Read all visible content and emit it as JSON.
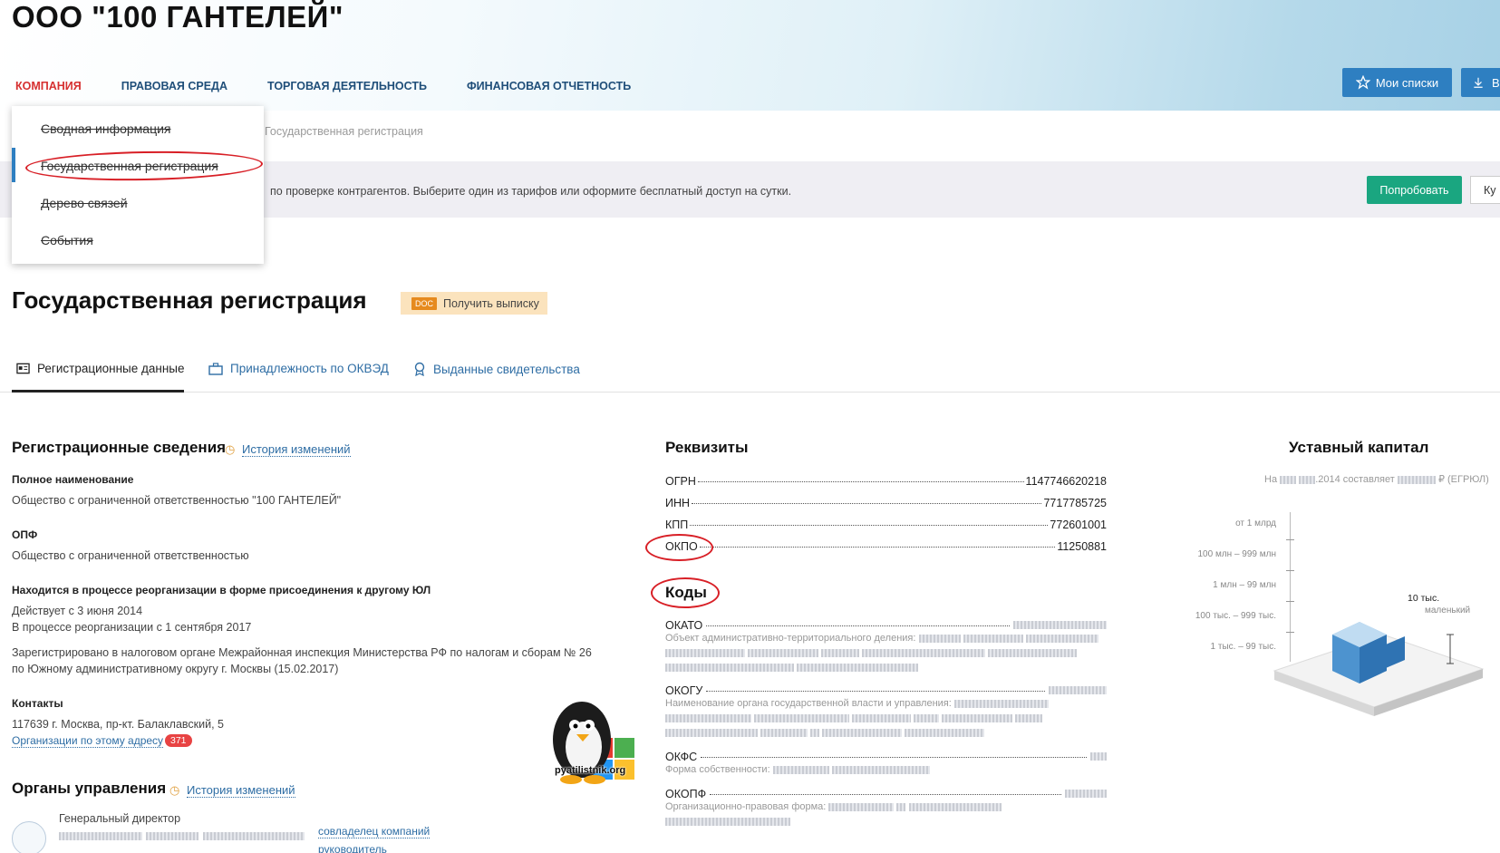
{
  "company": {
    "title": "ООО \"100 ГАНТЕЛЕЙ\""
  },
  "nav": {
    "items": [
      "КОМПАНИЯ",
      "ПРАВОВАЯ СРЕДА",
      "ТОРГОВАЯ ДЕЯТЕЛЬНОСТЬ",
      "ФИНАНСОВАЯ ОТЧЕТНОСТЬ"
    ],
    "my_lists": "Мои списки",
    "download": "В"
  },
  "dropdown": {
    "items": [
      "Сводная информация",
      "Государственная регистрация",
      "Дерево связей",
      "События"
    ]
  },
  "breadcrumb": "Государственная регистрация",
  "promo": {
    "text": "по проверке контрагентов. Выберите один из тарифов или оформите бесплатный доступ на сутки.",
    "try": "Попробовать",
    "buy": "Ку"
  },
  "page": {
    "title": "Государственная регистрация",
    "doc_badge": "DOC",
    "doc_label": "Получить выписку"
  },
  "tabs": [
    "Регистрационные данные",
    "Принадлежность по ОКВЭД",
    "Выданные свидетельства"
  ],
  "reg": {
    "title": "Регистрационные сведения",
    "history": "История изменений",
    "full_name_label": "Полное наименование",
    "full_name": "Общество с ограниченной ответственностью \"100 ГАНТЕЛЕЙ\"",
    "opf_label": "ОПФ",
    "opf": "Общество с ограниченной ответственностью",
    "reorg_label": "Находится в процессе реорганизации в форме присоединения к другому ЮЛ",
    "reorg_since": "Действует с 3 июня 2014",
    "reorg_process": "В процессе реорганизации с 1 сентября 2017",
    "registered_1": "Зарегистрировано в налоговом органе Межрайонная инспекция Министерства РФ по налогам и сборам № 26",
    "registered_2": "по Южному административному округу г. Москвы (15.02.2017)",
    "contacts_label": "Контакты",
    "address": "117639 г. Москва, пр-кт. Балаклавский, 5",
    "orgs_link": "Организации по этому адресу",
    "orgs_count": "371"
  },
  "mgmt": {
    "title": "Органы управления",
    "history": "История изменений",
    "role": "Генеральный директор",
    "link1": "совладелец компаний",
    "link2": "руководитель"
  },
  "requisites": {
    "title": "Реквизиты",
    "rows": [
      {
        "k": "ОГРН",
        "v": "1147746620218"
      },
      {
        "k": "ИНН",
        "v": "7717785725"
      },
      {
        "k": "КПП",
        "v": "772601001"
      },
      {
        "k": "ОКПО",
        "v": "11250881"
      }
    ]
  },
  "codes": {
    "title": "Коды",
    "okato": "ОКАТО",
    "okato_sub": "Объект административно-территориального деления:",
    "okogu": "ОКОГУ",
    "okogu_sub": "Наименование органа государственной власти и управления:",
    "okfs": "ОКФС",
    "okfs_sub": "Форма собственности:",
    "okopf": "ОКОПФ",
    "okopf_sub": "Организационно-правовая форма:"
  },
  "capital": {
    "title": "Уставный капитал",
    "sub_prefix": "На",
    "sub_mid": ".2014 составляет",
    "sub_suffix": "₽ (ЕГРЮЛ)",
    "scale": [
      "от 1 млрд",
      "100 млн – 999 млн",
      "1 млн – 99 млн",
      "100 тыс. – 999 тыс.",
      "1 тыс. – 99 тыс."
    ],
    "level_value": "10 тыс.",
    "level_label": "маленький"
  },
  "watermark": "pyatilistnik.org",
  "colors": {
    "accent": "#2e7fc1",
    "active_nav": "#d63030",
    "try_button": "#1aa680",
    "highlight_oval": "#d81f26"
  }
}
